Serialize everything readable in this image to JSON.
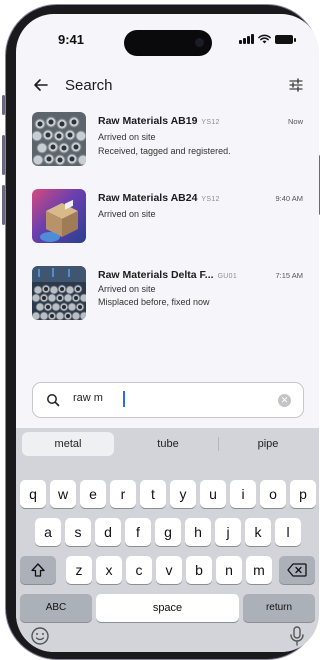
{
  "status_bar": {
    "time": "9:41"
  },
  "header": {
    "title": "Search"
  },
  "results": [
    {
      "title_match": "Raw M",
      "title_rest": "aterials AB19",
      "code": "YS12",
      "time": "Now",
      "status": "Arrived on site",
      "note": "Received, tagged and registered."
    },
    {
      "title_match": "Raw M",
      "title_rest": "aterials AB24",
      "code": "YS12",
      "time": "9:40 AM",
      "status": "Arrived on site",
      "note": ""
    },
    {
      "title_match": "Raw M",
      "title_rest": "aterials Delta F...",
      "code": "GU01",
      "time": "7:15 AM",
      "status": "Arrived on site",
      "note": "Misplaced before, fixed now"
    }
  ],
  "search": {
    "value": "raw m"
  },
  "keyboard": {
    "suggestions": [
      "metal",
      "tube",
      "pipe"
    ],
    "row1": [
      "q",
      "w",
      "e",
      "r",
      "t",
      "y",
      "u",
      "i",
      "o",
      "p"
    ],
    "row2": [
      "a",
      "s",
      "d",
      "f",
      "g",
      "h",
      "j",
      "k",
      "l"
    ],
    "row3": [
      "z",
      "x",
      "c",
      "v",
      "b",
      "n",
      "m"
    ],
    "abc_label": "ABC",
    "space_label": "space",
    "return_label": "return"
  }
}
